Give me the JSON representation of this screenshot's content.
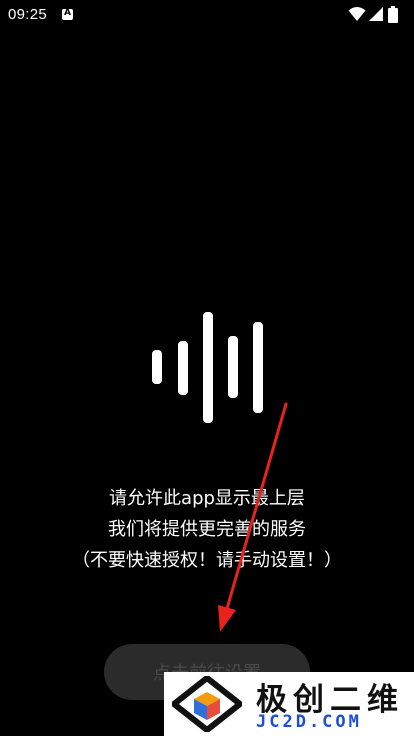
{
  "status_bar": {
    "time": "09:25",
    "notification_icon_letter": "A",
    "icons": [
      "wifi-icon",
      "cell-signal-icon",
      "battery-icon"
    ]
  },
  "message": {
    "line1": "请允许此app显示最上层",
    "line2": "我们将提供更完善的服务",
    "line3": "（不要快速授权！请手动设置！）"
  },
  "button": {
    "label": "点击前往设置"
  },
  "watermark": {
    "title": "极创二维",
    "url": "JC2D.COM"
  },
  "colors": {
    "background": "#000000",
    "text": "#ffffff",
    "button_bg": "#2b2b2b",
    "arrow": "#e8231c",
    "watermark_url": "#1a4fd6"
  }
}
